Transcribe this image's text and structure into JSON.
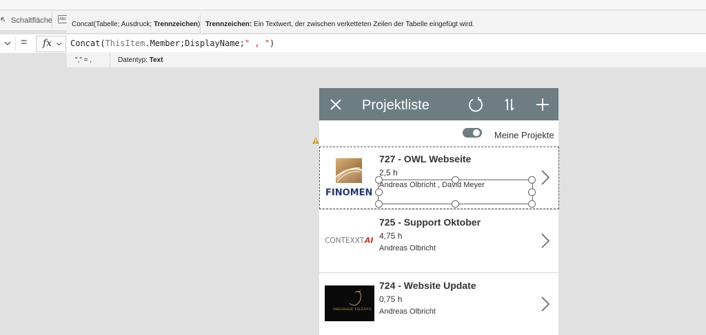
{
  "ribbon": {
    "button_label": "Schaltfläche",
    "abc_label": "Abc"
  },
  "tooltip": {
    "signature_prefix": "Concat(Tabelle; Ausdruck; ",
    "signature_active": "Trennzeichen",
    "signature_suffix": ")",
    "param_name": "Trennzeichen:",
    "param_desc": " Ein Textwert, der zwischen verketteten Zeilen der Tabelle eingefügt wird."
  },
  "formula_bar": {
    "equals": "=",
    "fx": "fx",
    "formula_fn": "Concat(",
    "formula_item": "ThisItem",
    "formula_mid": ".Member;DisplayName;",
    "formula_str": "\" , \"",
    "formula_end": ")"
  },
  "result": {
    "value": "\",\" = ,",
    "datatype_label": "Datentyp: ",
    "datatype_value": "Text"
  },
  "app": {
    "title": "Projektliste",
    "toggle_label": "Meine Projekte",
    "toggle_on": true,
    "header_color": "#6d7d81",
    "projects": [
      {
        "title": "727 - OWL Webseite",
        "hours": "2,5 h",
        "members": "Andreas Olbricht , David Meyer",
        "logo": "FINOMEN"
      },
      {
        "title": "725 - Support Oktober",
        "hours": "4,75 h",
        "members": "Andreas Olbricht",
        "logo": "CONTEXXT"
      },
      {
        "title": "724 - Website Update",
        "hours": "0,75 h",
        "members": "Andreas Olbricht",
        "logo": "DRESSAGE TALENTS"
      }
    ]
  },
  "icons": [
    "button-icon",
    "abc-icon",
    "chevron-down-icon",
    "close-icon",
    "refresh-icon",
    "sort-icon",
    "add-icon",
    "chevron-right-icon",
    "warning-icon"
  ]
}
